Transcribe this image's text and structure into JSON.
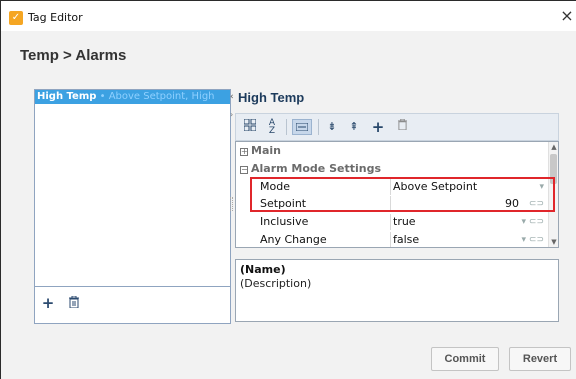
{
  "window": {
    "title": "Tag Editor",
    "close_glyph": "×",
    "app_icon": "check-icon"
  },
  "breadcrumb": "Temp > Alarms",
  "alarms_list": {
    "items": [
      {
        "name": "High Temp",
        "separator": " • ",
        "description": "Above Setpoint, High"
      }
    ],
    "add_glyph": "+",
    "delete_glyph": "🗑"
  },
  "editor": {
    "title": "High Temp",
    "toolbar": {
      "categorized_icon": "categorized-view-icon",
      "alphabetical_icon": "sort-alpha-icon",
      "property_pages_icon": "property-pages-icon",
      "expand_icon": "expand-all-icon",
      "collapse_icon": "collapse-all-icon",
      "add_glyph": "+",
      "delete_glyph": "🗑"
    },
    "sections": [
      {
        "label": "Main",
        "expanded": false,
        "toggle": "+"
      },
      {
        "label": "Alarm Mode Settings",
        "expanded": true,
        "toggle": "−"
      }
    ],
    "properties": [
      {
        "name": "Mode",
        "value": "Above Setpoint",
        "control": "▾"
      },
      {
        "name": "Setpoint",
        "value": "90",
        "control": "⊂⊃"
      },
      {
        "name": "Inclusive",
        "value": "true",
        "control": "▾ ⊂⊃"
      },
      {
        "name": "Any Change",
        "value": "false",
        "control": "▾ ⊂⊃"
      }
    ],
    "description_panel": {
      "name": "(Name)",
      "description": "(Description)"
    }
  },
  "buttons": {
    "commit": "Commit",
    "revert": "Revert"
  },
  "colors": {
    "selection": "#3ca1e2",
    "highlight": "#e0262b",
    "title_color": "#1d3b5c"
  }
}
